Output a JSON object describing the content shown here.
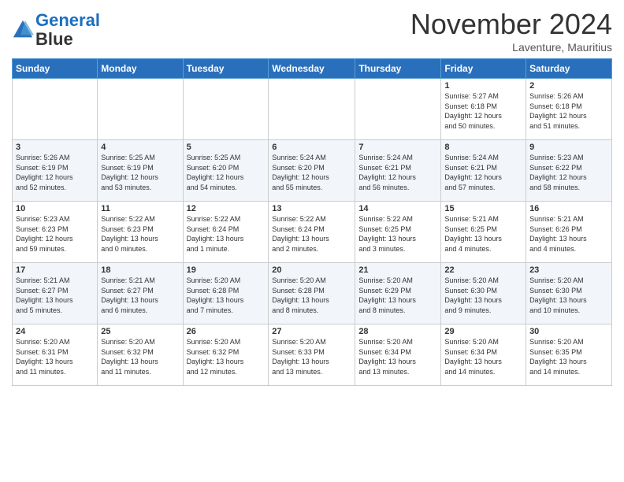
{
  "header": {
    "logo_line1": "General",
    "logo_line2": "Blue",
    "month_title": "November 2024",
    "location": "Laventure, Mauritius"
  },
  "weekdays": [
    "Sunday",
    "Monday",
    "Tuesday",
    "Wednesday",
    "Thursday",
    "Friday",
    "Saturday"
  ],
  "weeks": [
    [
      {
        "day": "",
        "info": ""
      },
      {
        "day": "",
        "info": ""
      },
      {
        "day": "",
        "info": ""
      },
      {
        "day": "",
        "info": ""
      },
      {
        "day": "",
        "info": ""
      },
      {
        "day": "1",
        "info": "Sunrise: 5:27 AM\nSunset: 6:18 PM\nDaylight: 12 hours\nand 50 minutes."
      },
      {
        "day": "2",
        "info": "Sunrise: 5:26 AM\nSunset: 6:18 PM\nDaylight: 12 hours\nand 51 minutes."
      }
    ],
    [
      {
        "day": "3",
        "info": "Sunrise: 5:26 AM\nSunset: 6:19 PM\nDaylight: 12 hours\nand 52 minutes."
      },
      {
        "day": "4",
        "info": "Sunrise: 5:25 AM\nSunset: 6:19 PM\nDaylight: 12 hours\nand 53 minutes."
      },
      {
        "day": "5",
        "info": "Sunrise: 5:25 AM\nSunset: 6:20 PM\nDaylight: 12 hours\nand 54 minutes."
      },
      {
        "day": "6",
        "info": "Sunrise: 5:24 AM\nSunset: 6:20 PM\nDaylight: 12 hours\nand 55 minutes."
      },
      {
        "day": "7",
        "info": "Sunrise: 5:24 AM\nSunset: 6:21 PM\nDaylight: 12 hours\nand 56 minutes."
      },
      {
        "day": "8",
        "info": "Sunrise: 5:24 AM\nSunset: 6:21 PM\nDaylight: 12 hours\nand 57 minutes."
      },
      {
        "day": "9",
        "info": "Sunrise: 5:23 AM\nSunset: 6:22 PM\nDaylight: 12 hours\nand 58 minutes."
      }
    ],
    [
      {
        "day": "10",
        "info": "Sunrise: 5:23 AM\nSunset: 6:23 PM\nDaylight: 12 hours\nand 59 minutes."
      },
      {
        "day": "11",
        "info": "Sunrise: 5:22 AM\nSunset: 6:23 PM\nDaylight: 13 hours\nand 0 minutes."
      },
      {
        "day": "12",
        "info": "Sunrise: 5:22 AM\nSunset: 6:24 PM\nDaylight: 13 hours\nand 1 minute."
      },
      {
        "day": "13",
        "info": "Sunrise: 5:22 AM\nSunset: 6:24 PM\nDaylight: 13 hours\nand 2 minutes."
      },
      {
        "day": "14",
        "info": "Sunrise: 5:22 AM\nSunset: 6:25 PM\nDaylight: 13 hours\nand 3 minutes."
      },
      {
        "day": "15",
        "info": "Sunrise: 5:21 AM\nSunset: 6:25 PM\nDaylight: 13 hours\nand 4 minutes."
      },
      {
        "day": "16",
        "info": "Sunrise: 5:21 AM\nSunset: 6:26 PM\nDaylight: 13 hours\nand 4 minutes."
      }
    ],
    [
      {
        "day": "17",
        "info": "Sunrise: 5:21 AM\nSunset: 6:27 PM\nDaylight: 13 hours\nand 5 minutes."
      },
      {
        "day": "18",
        "info": "Sunrise: 5:21 AM\nSunset: 6:27 PM\nDaylight: 13 hours\nand 6 minutes."
      },
      {
        "day": "19",
        "info": "Sunrise: 5:20 AM\nSunset: 6:28 PM\nDaylight: 13 hours\nand 7 minutes."
      },
      {
        "day": "20",
        "info": "Sunrise: 5:20 AM\nSunset: 6:28 PM\nDaylight: 13 hours\nand 8 minutes."
      },
      {
        "day": "21",
        "info": "Sunrise: 5:20 AM\nSunset: 6:29 PM\nDaylight: 13 hours\nand 8 minutes."
      },
      {
        "day": "22",
        "info": "Sunrise: 5:20 AM\nSunset: 6:30 PM\nDaylight: 13 hours\nand 9 minutes."
      },
      {
        "day": "23",
        "info": "Sunrise: 5:20 AM\nSunset: 6:30 PM\nDaylight: 13 hours\nand 10 minutes."
      }
    ],
    [
      {
        "day": "24",
        "info": "Sunrise: 5:20 AM\nSunset: 6:31 PM\nDaylight: 13 hours\nand 11 minutes."
      },
      {
        "day": "25",
        "info": "Sunrise: 5:20 AM\nSunset: 6:32 PM\nDaylight: 13 hours\nand 11 minutes."
      },
      {
        "day": "26",
        "info": "Sunrise: 5:20 AM\nSunset: 6:32 PM\nDaylight: 13 hours\nand 12 minutes."
      },
      {
        "day": "27",
        "info": "Sunrise: 5:20 AM\nSunset: 6:33 PM\nDaylight: 13 hours\nand 13 minutes."
      },
      {
        "day": "28",
        "info": "Sunrise: 5:20 AM\nSunset: 6:34 PM\nDaylight: 13 hours\nand 13 minutes."
      },
      {
        "day": "29",
        "info": "Sunrise: 5:20 AM\nSunset: 6:34 PM\nDaylight: 13 hours\nand 14 minutes."
      },
      {
        "day": "30",
        "info": "Sunrise: 5:20 AM\nSunset: 6:35 PM\nDaylight: 13 hours\nand 14 minutes."
      }
    ]
  ]
}
